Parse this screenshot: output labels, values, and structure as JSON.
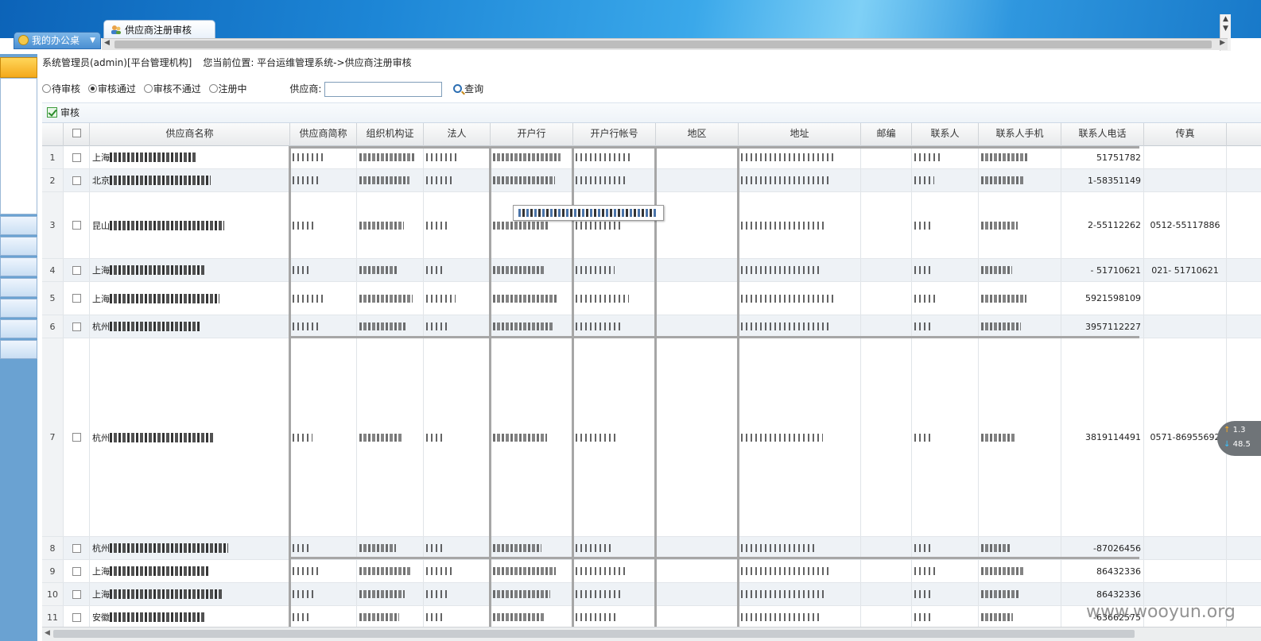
{
  "tabs": {
    "desktop": "我的办公桌",
    "active": "供应商注册审核"
  },
  "breadcrumb": {
    "user": "系统管理员(admin)[平台管理机构]",
    "location": "您当前位置: 平台运维管理系统->供应商注册审核"
  },
  "filter": {
    "options": [
      "待审核",
      "审核通过",
      "审核不通过",
      "注册中"
    ],
    "selected": "审核通过",
    "supplier_label": "供应商:",
    "supplier_value": "",
    "query_label": "查询"
  },
  "toolbar": {
    "audit_label": "审核"
  },
  "grid": {
    "columns": [
      "供应商名称",
      "供应商简称",
      "组织机构证",
      "法人",
      "开户行",
      "开户行帐号",
      "地区",
      "地址",
      "邮编",
      "联系人",
      "联系人手机",
      "联系人电话",
      "传真"
    ],
    "rows": [
      {
        "num": "1",
        "name_prefix": "上海",
        "phone": "51751782",
        "fax": ""
      },
      {
        "num": "2",
        "name_prefix": "北京",
        "phone": "1-58351149",
        "fax": ""
      },
      {
        "num": "3",
        "name_prefix": "昆山",
        "phone": "2-55112262",
        "fax": "0512-55117886"
      },
      {
        "num": "4",
        "name_prefix": "上海",
        "phone": "- 51710621",
        "fax": "021- 51710621"
      },
      {
        "num": "5",
        "name_prefix": "上海",
        "phone": "5921598109",
        "fax": ""
      },
      {
        "num": "6",
        "name_prefix": "杭州",
        "phone": "3957112227",
        "fax": ""
      },
      {
        "num": "7",
        "name_prefix": "杭州",
        "phone": "3819114491",
        "fax": "0571-86955692"
      },
      {
        "num": "8",
        "name_prefix": "杭州",
        "phone": "-87026456",
        "fax": ""
      },
      {
        "num": "9",
        "name_prefix": "上海",
        "phone": "86432336",
        "fax": ""
      },
      {
        "num": "10",
        "name_prefix": "上海",
        "phone": "86432336",
        "fax": ""
      },
      {
        "num": "11",
        "name_prefix": "安徽",
        "phone": "-63662575",
        "fax": ""
      }
    ]
  },
  "widget": {
    "up": "1.3",
    "down": "48.5"
  },
  "watermark": "www.wooyun.org",
  "colors": {
    "banner": "#1d86d6",
    "sidebar": "#6aa2d2",
    "row_alt": "#eef2f6",
    "accent_orange": "#f4a91b"
  }
}
